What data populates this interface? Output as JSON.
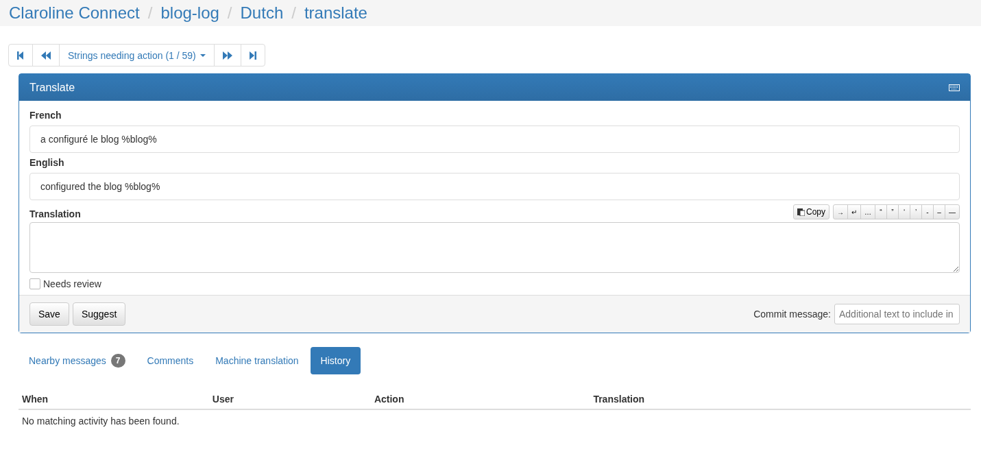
{
  "breadcrumb": {
    "separator": "/",
    "items": [
      "Claroline Connect",
      "blog-log",
      "Dutch",
      "translate"
    ]
  },
  "navigator": {
    "label": "Strings needing action (1 / 59)"
  },
  "panel": {
    "title": "Translate",
    "sources": [
      {
        "label": "French",
        "value": "a configuré le blog %blog%"
      },
      {
        "label": "English",
        "value": "configured the blog %blog%"
      }
    ],
    "translation": {
      "label": "Translation",
      "copy_button": "Copy",
      "special_chars": [
        "→",
        "↵",
        "…",
        "“",
        "”",
        "‘",
        "’",
        "-",
        "–",
        "—"
      ]
    },
    "needs_review": {
      "label": "Needs review",
      "checked": false
    },
    "buttons": [
      "Save",
      "Suggest"
    ],
    "commit": {
      "label": "Commit message:",
      "placeholder": "Additional text to include in"
    }
  },
  "tabs": [
    {
      "label": "Nearby messages",
      "badge": "7",
      "selected": false
    },
    {
      "label": "Comments",
      "selected": false
    },
    {
      "label": "Machine translation",
      "selected": false
    },
    {
      "label": "History",
      "selected": true
    }
  ],
  "table": {
    "columns": [
      "When",
      "User",
      "Action",
      "Translation"
    ],
    "empty": "No matching activity has been found."
  }
}
